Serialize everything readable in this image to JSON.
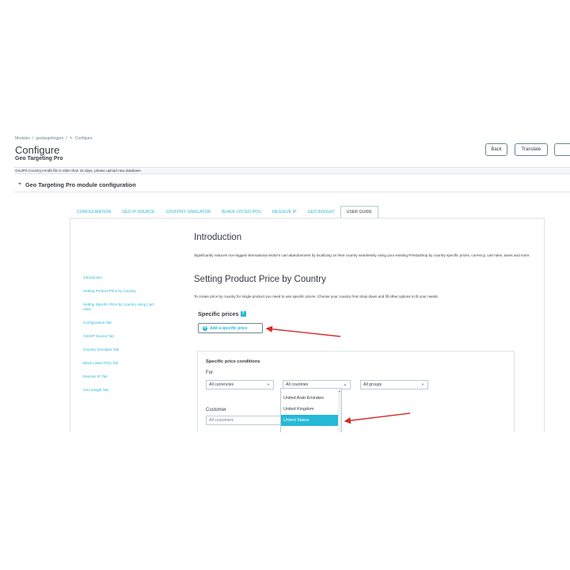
{
  "breadcrumb": {
    "item1": "Modules",
    "sep1": "/",
    "item2": "geotargetingpro",
    "sep2": "/",
    "item3": "Configure"
  },
  "header": {
    "title": "Configure",
    "subtitle": "Geo Targeting Pro",
    "back_label": "Back",
    "translate_label": "Translate"
  },
  "alert": {
    "text": "GeoIP2-Country.mmdb file is older than 15 days, please upload new database."
  },
  "panel": {
    "title": "Geo Targeting Pro module configuration"
  },
  "tabs": [
    {
      "label": "CONFIGURATION"
    },
    {
      "label": "GEO IP SOURCE"
    },
    {
      "label": "COUNTRY SIMULATOR"
    },
    {
      "label": "BLACK LISTED IP(S)"
    },
    {
      "label": "RESOLVE IP"
    },
    {
      "label": "GEO INSIGHT"
    },
    {
      "label": "USER GUIDE"
    }
  ],
  "guide_nav": [
    {
      "label": "Introduction"
    },
    {
      "label": "Setting Product Price by Country"
    },
    {
      "label": "Setting Specific Price by Country using Cart rules"
    },
    {
      "label": "Configuration Tab"
    },
    {
      "label": "GEOIP Source Tab"
    },
    {
      "label": "Country Simulator Tab"
    },
    {
      "label": "Black Listed IP(s) Tab"
    },
    {
      "label": "Resolve IP Tab"
    },
    {
      "label": "Geo Insight Tab"
    }
  ],
  "guide": {
    "intro_heading": "Introduction",
    "intro_text": "Significantly reduces non-logged international visitor's cart abandonment by localizing on their country seamlessly using your existing PrestaShop by country specific prices, currency, cart rules, taxes and more.",
    "setting_heading": "Setting Product Price by Country",
    "setting_text": "To create price by country for single product you need to use specific prices. Choose your country from drop down and fill other options to fit your needs."
  },
  "screenshot": {
    "specific_prices_label": "Specific prices",
    "help_icon_text": "?",
    "add_button_label": "Add a specific price",
    "conditions_title": "Specific price conditions",
    "for_label": "For",
    "currency_value": "All currencies",
    "country_value": "All countries",
    "group_value": "All groups",
    "customer_label": "Customer",
    "customer_placeholder": "All customers",
    "dropdown_options": [
      {
        "label": "United Arab Emirates"
      },
      {
        "label": "United Kingdom"
      },
      {
        "label": "United States"
      }
    ]
  },
  "colors": {
    "accent": "#25b9d7",
    "arrow": "#d62b2b",
    "text": "#363a41"
  }
}
